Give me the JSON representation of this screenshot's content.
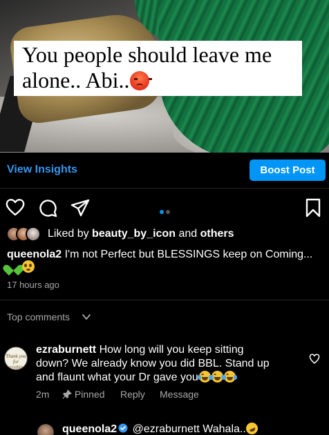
{
  "photo": {
    "overlay_text_line1": "You people should leave me",
    "overlay_text_line2": "alone.. Abi..",
    "overlay_emoji": "angry-face"
  },
  "insights": {
    "view_insights_label": "View Insights",
    "boost_post_label": "Boost Post"
  },
  "actions": {
    "icons": [
      "heart-icon",
      "comment-icon",
      "share-icon",
      "save-icon"
    ],
    "carousel_dots": 2,
    "carousel_active_index": 0
  },
  "likes": {
    "prefix": "Liked by",
    "user": "beauty_by_icon",
    "joiner": "and",
    "others": "others"
  },
  "post": {
    "username": "queenola2",
    "caption": "I'm not Perfect but BLESSINGS keep on Coming...",
    "caption_emojis": [
      "green-heart",
      "pleading-face"
    ],
    "timestamp": "17 hours ago"
  },
  "comments_section": {
    "header": "Top comments"
  },
  "comment": {
    "username": "ezraburnett",
    "avatar_text": "Thank you for everything!",
    "text_part1": "How long will you keep sitting",
    "text_part2": "down? We already know you did BBL. Stand up",
    "text_part3": "and flaunt what your Dr gave you",
    "emojis": [
      "joy",
      "joy",
      "joy"
    ],
    "time": "2m",
    "pinned_label": "Pinned",
    "reply_label": "Reply",
    "message_label": "Message"
  },
  "reply": {
    "username": "queenola2",
    "mention": "@ezraburnett",
    "text": "Wahala..",
    "emoji": "rolling-on-floor-laughing"
  },
  "colors": {
    "background": "#000000",
    "accent_blue": "#0095f6",
    "link_blue": "#3897f0",
    "muted_text": "#a8a8a8"
  }
}
